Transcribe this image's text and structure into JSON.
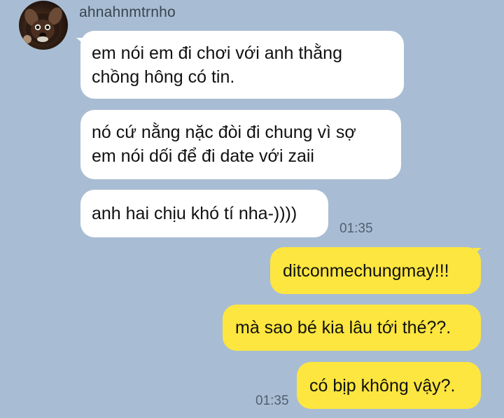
{
  "chat": {
    "sender": {
      "name": "ahnahnmtrnho",
      "avatar_icon": "puppy-avatar-icon"
    },
    "incoming": [
      {
        "text": "em nói em đi chơi với anh thằng\nchồng hông có tin."
      },
      {
        "text": "nó cứ nằng nặc đòi đi chung vì sợ\nem nói dối để đi date với zaii"
      },
      {
        "text": "anh hai chịu khó tí nha-))))"
      }
    ],
    "incoming_time": "01:35",
    "outgoing": [
      {
        "text": "ditconmechungmay!!!"
      },
      {
        "text": "mà sao bé kia lâu tới thé??."
      },
      {
        "text": "có bịp không vậy?."
      }
    ],
    "outgoing_time": "01:35"
  },
  "colors": {
    "background": "#a8bdd3",
    "incoming_bubble": "#ffffff",
    "outgoing_bubble": "#fde63f",
    "timestamp": "#4f5f70"
  }
}
